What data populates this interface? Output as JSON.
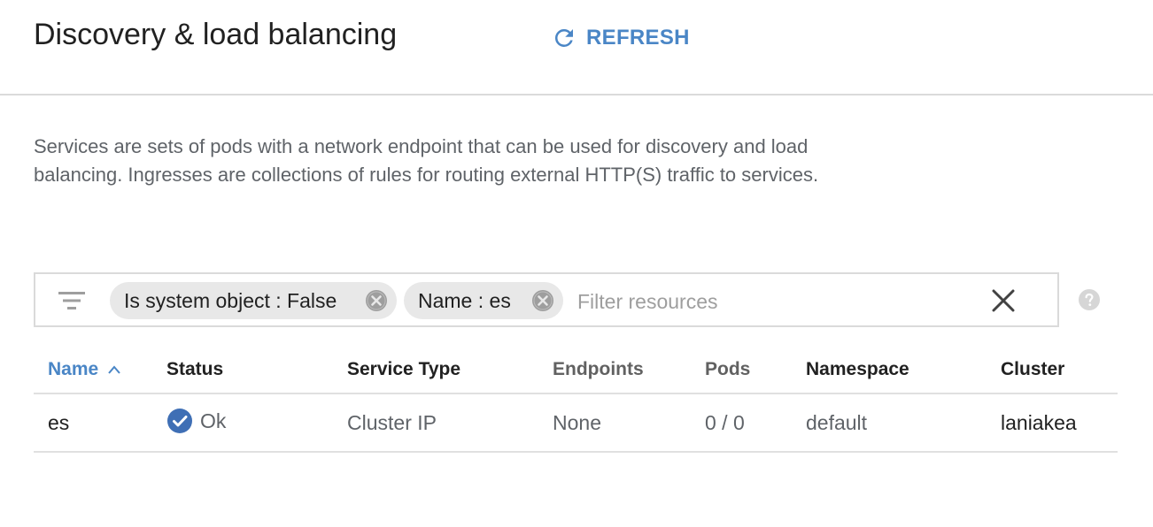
{
  "header": {
    "title": "Discovery & load balancing",
    "refresh_label": "REFRESH"
  },
  "description": "Services are sets of pods with a network endpoint that can be used for discovery and load balancing. Ingresses are collections of rules for routing external HTTP(S) traffic to services.",
  "filter": {
    "chips": [
      {
        "label": "Is system object : False"
      },
      {
        "label": "Name : es"
      }
    ],
    "placeholder": "Filter resources",
    "icons": [
      "filter-list-icon",
      "close-icon",
      "help-icon"
    ]
  },
  "table": {
    "columns": [
      "Name",
      "Status",
      "Service Type",
      "Endpoints",
      "Pods",
      "Namespace",
      "Cluster"
    ],
    "sorted_column": "Name",
    "sort_direction": "ascending",
    "rows": [
      {
        "name": "es",
        "status": "Ok",
        "service_type": "Cluster IP",
        "endpoints": "None",
        "pods": "0 / 0",
        "namespace": "default",
        "cluster": "laniakea"
      }
    ]
  },
  "colors": {
    "accent": "#4a86c6",
    "status_ok": "#3f6fb5",
    "chip_bg": "#e8e8e8",
    "border": "#dadada"
  }
}
